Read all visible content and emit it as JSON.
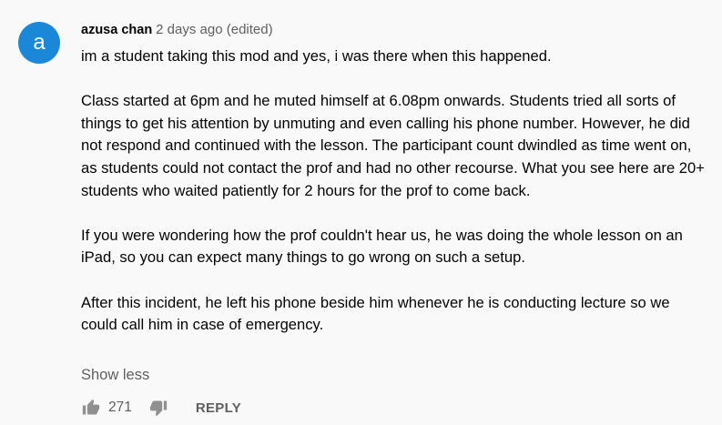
{
  "comment": {
    "avatar_letter": "a",
    "avatar_color": "#1a88d6",
    "author": "azusa chan",
    "meta": "2 days ago (edited)",
    "paragraphs": [
      "im a student taking this mod and yes, i was there when this happened.",
      "Class started at 6pm and he muted himself at 6.08pm onwards. Students tried all sorts of things to get his attention by unmuting and even calling his phone number. However, he did not respond and continued with the lesson. The participant count dwindled as time went on, as students could not contact the prof and had no other recourse. What you see here are 20+ students who waited patiently for 2 hours for the prof to come back.",
      "If you were wondering how the prof couldn't hear us, he was doing the whole lesson on an iPad, so you can expect many things to go wrong on such a setup.",
      "After this incident, he left his phone beside him whenever he is conducting lecture so we could call him in case of emergency."
    ],
    "show_less_label": "Show less",
    "like_icon": "thumbs-up-icon",
    "like_count": "271",
    "dislike_icon": "thumbs-down-icon",
    "reply_label": "REPLY"
  }
}
